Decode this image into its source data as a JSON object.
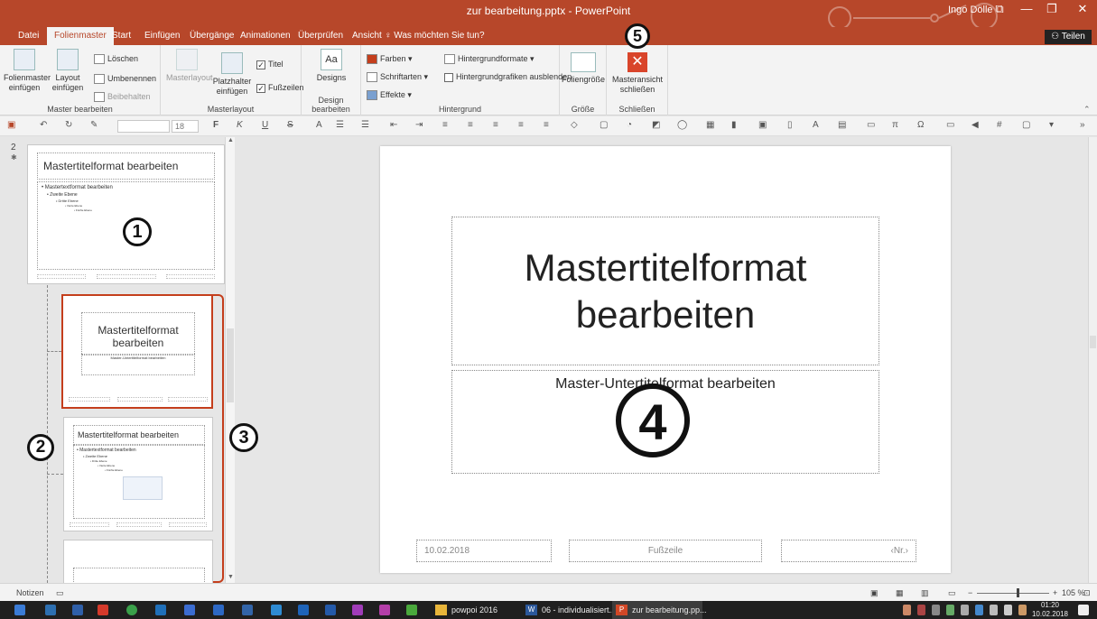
{
  "title_bar": {
    "document_title": "zur bearbeitung.pptx - PowerPoint",
    "user_name": "Ingo Dölle",
    "restore_symbol": "⧉",
    "minimize_symbol": "—",
    "maximize_symbol": "❐",
    "close_symbol": "✕"
  },
  "ribbon_tabs": [
    "Datei",
    "Folienmaster",
    "Start",
    "Einfügen",
    "Übergänge",
    "Animationen",
    "Überprüfen",
    "Ansicht",
    "Was möchten Sie tun?"
  ],
  "share_label": "Teilen",
  "groups": {
    "master_bearbeiten": {
      "label": "Master bearbeiten",
      "insert_master": "Folienmaster einfügen",
      "insert_layout": "Layout einfügen",
      "delete": "Löschen",
      "rename": "Umbenennen",
      "keep": "Beibehalten"
    },
    "masterlayout": {
      "label": "Masterlayout",
      "masterlayout_btn": "Masterlayout",
      "insert_placeholder": "Platzhalter einfügen",
      "title": "Titel",
      "footer": "Fußzeilen",
      "check_mark": "✓"
    },
    "design_bearbeiten": {
      "label": "Design bearbeiten",
      "designs": "Designs",
      "designs_glyph": "Aa"
    },
    "hintergrund": {
      "label": "Hintergrund",
      "colors": "Farben",
      "fonts": "Schriftarten",
      "effects": "Effekte",
      "background_formats": "Hintergrundformate",
      "hide_bg_graphics": "Hintergrundgrafiken ausblenden"
    },
    "groesse": {
      "label": "Größe",
      "slide_size": "Foliengröße"
    },
    "schliessen": {
      "label": "Schließen",
      "close_master_view": "Masteransicht schließen",
      "close_glyph": "✕"
    }
  },
  "qat": {
    "font_size": "18",
    "bold": "F",
    "italic": "K",
    "underline": "U",
    "strike": "S"
  },
  "thumbnails": {
    "slide_number": "2",
    "master": {
      "title": "Mastertitelformat bearbeiten",
      "levels": [
        "• Mastertextformat bearbeiten",
        "• Zweite Ebene",
        "• Dritte Ebene",
        "• Vierte Ebene",
        "• Fünfte Ebene"
      ]
    },
    "layout1": {
      "title": "Mastertitelformat bearbeiten",
      "subtitle": "Master-Untertitelformat bearbeiten"
    },
    "layout2": {
      "title": "Mastertitelformat bearbeiten",
      "levels": [
        "• Mastertextformat bearbeiten",
        "• Zweite Ebene",
        "• Dritte Ebene",
        "• Vierte Ebene",
        "• Fünfte Ebene"
      ]
    }
  },
  "annotations": [
    "1",
    "2",
    "3",
    "4",
    "5"
  ],
  "slide": {
    "title": "Mastertitelformat bearbeiten",
    "subtitle": "Master-Untertitelformat bearbeiten",
    "date": "10.02.2018",
    "footer": "Fußzeile",
    "number": "‹Nr.›"
  },
  "statusbar": {
    "notes": "Notizen",
    "zoom": "105 %"
  },
  "taskbar": {
    "apps": [
      {
        "label": "powpoi 2016",
        "icon": "folder-icon",
        "color": "#e8b53a"
      },
      {
        "label": "06 - individualisiert...",
        "icon": "word-icon",
        "color": "#2b579a"
      },
      {
        "label": "zur bearbeitung.pp...",
        "icon": "powerpoint-icon",
        "color": "#d24726"
      }
    ],
    "time": "01:20",
    "date": "10.02.2018"
  },
  "colors": {
    "accent": "#b7472a",
    "selection": "#c43e1c"
  }
}
